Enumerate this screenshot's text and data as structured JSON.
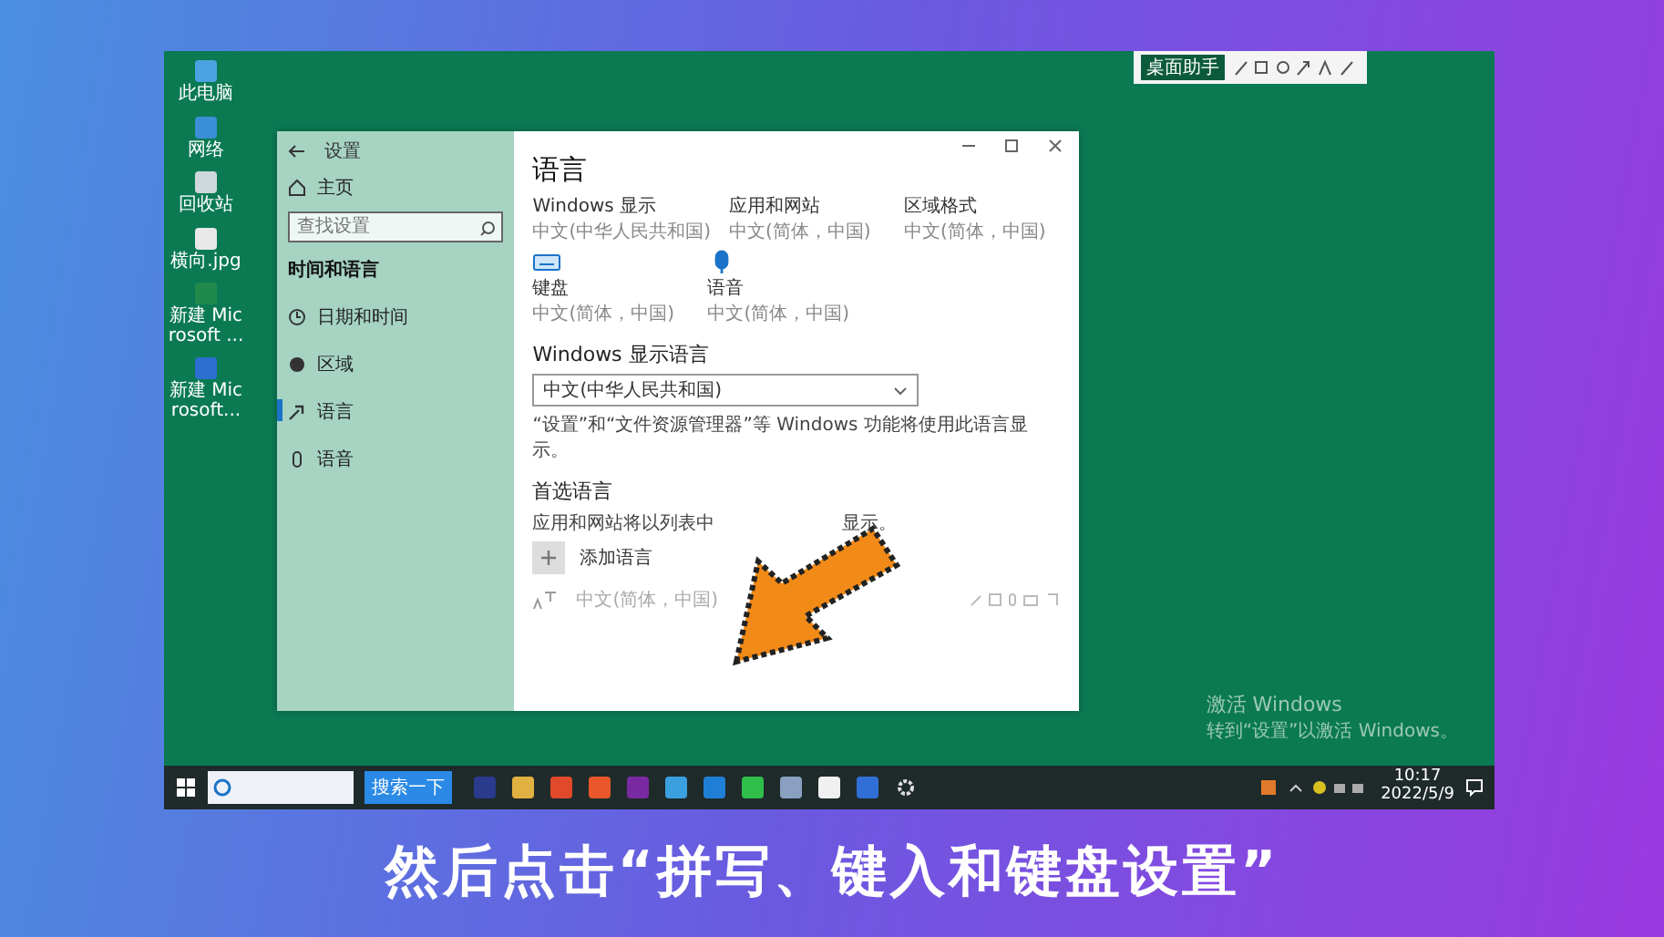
{
  "desktop_icons": [
    {
      "label": "此电脑",
      "color": "#4aa3e0"
    },
    {
      "label": "网络",
      "color": "#3b8fd6"
    },
    {
      "label": "回收站",
      "color": "#cfd8dc"
    },
    {
      "label": "横向.jpg",
      "color": "#e8e8e8"
    },
    {
      "label": "新建 Microsoft ...",
      "color": "#1f8a4c"
    },
    {
      "label": "新建 Microsoft...",
      "color": "#2b6fd1"
    }
  ],
  "toolbar": {
    "label": "桌面助手"
  },
  "settings_window": {
    "title": "设置",
    "nav": {
      "home": "主页",
      "search_placeholder": "查找设置",
      "section": "时间和语言",
      "items": [
        {
          "label": "日期和时间",
          "kind": "clock",
          "selected": false
        },
        {
          "label": "区域",
          "kind": "globe",
          "selected": false
        },
        {
          "label": "语言",
          "kind": "lang",
          "selected": true
        },
        {
          "label": "语音",
          "kind": "mic",
          "selected": false
        }
      ]
    },
    "content": {
      "heading": "语言",
      "tiles": [
        {
          "title": "Windows 显示",
          "subtitle": "中文(中华人民共和国)"
        },
        {
          "title": "应用和网站",
          "subtitle": "中文(简体，中国)"
        },
        {
          "title": "区域格式",
          "subtitle": "中文(简体，中国)"
        }
      ],
      "icon_tiles": [
        {
          "kind": "keyboard",
          "title": "键盘",
          "subtitle": "中文(简体，中国)"
        },
        {
          "kind": "mic",
          "title": "语音",
          "subtitle": "中文(简体，中国)"
        }
      ],
      "display_language": {
        "heading": "Windows 显示语言",
        "value": "中文(中华人民共和国)",
        "note": "“设置”和“文件资源管理器”等 Windows 功能将使用此语言显示。"
      },
      "preferred": {
        "heading": "首选语言",
        "note_start": "应用和网站将以列表中",
        "note_end": "显示。",
        "add_button": "添加语言",
        "languages": [
          {
            "name": "中文(简体，中国)"
          }
        ]
      }
    }
  },
  "activation": {
    "title": "激活 Windows",
    "text": "转到“设置”以激活 Windows。"
  },
  "taskbar": {
    "search_button": "搜索一下",
    "apps": [
      {
        "color": "#2a3a8c"
      },
      {
        "color": "#e0b040"
      },
      {
        "color": "#e04a2a"
      },
      {
        "color": "#e8582a"
      },
      {
        "color": "#7a2aa0"
      },
      {
        "color": "#3aa0e0"
      },
      {
        "color": "#1f7fd6"
      },
      {
        "color": "#2fbf4a"
      },
      {
        "color": "#8aa0c0"
      },
      {
        "color": "#f0f0f0"
      },
      {
        "color": "#2f6fd6"
      }
    ],
    "time": "10:17",
    "date": "2022/5/9"
  },
  "subtitle": "然后点击“拼写、键入和键盘设置”"
}
